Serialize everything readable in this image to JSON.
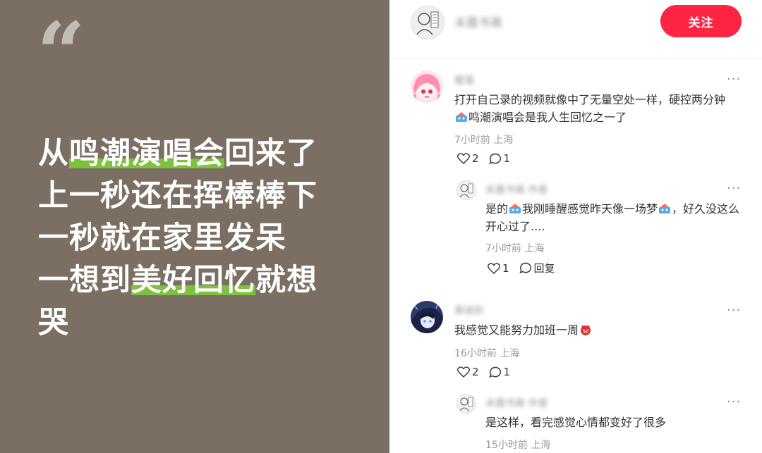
{
  "note": {
    "quote_glyph": "“",
    "lines": [
      {
        "pre": "从",
        "hl": "鸣潮演唱会",
        "post": "回来了"
      },
      {
        "pre": "上一秒还在挥棒棒下",
        "hl": "",
        "post": ""
      },
      {
        "pre": "一秒就在家里发呆",
        "hl": "",
        "post": ""
      },
      {
        "pre": "一想到",
        "hl": "美好回忆",
        "post": "就想"
      },
      {
        "pre": "哭",
        "hl": "",
        "post": ""
      }
    ],
    "highlight_color": "#7cc23d",
    "background_color": "#7b6e62"
  },
  "header": {
    "author_name": "未露书斋",
    "follow_label": "关注",
    "follow_color": "#ff2442"
  },
  "comments": [
    {
      "name": "樱落",
      "text_a": "打开自己录的视频就像中了无量空处一样，硬控两分钟",
      "text_b": "鸣潮演唱会是我人生回忆之一了",
      "meta": "7小时前 上海",
      "likes": "2",
      "replies": "1",
      "more": "···"
    },
    {
      "name": "未露书斋",
      "author_tag": "作者",
      "text_a": "是的",
      "text_b": "我刚睡醒感觉昨天像一场梦",
      "text_c": "，好久没这么开心过了....",
      "meta": "7小时前 上海",
      "likes": "1",
      "reply_label": "回复",
      "more": "···"
    },
    {
      "name": "霁夜轩",
      "text": "我感觉又能努力加班一周",
      "meta": "16小时前 上海",
      "likes": "2",
      "replies": "1",
      "more": "···"
    },
    {
      "name": "未露书斋",
      "author_tag": "作者",
      "text": "是这样，看完感觉心情都变好了很多",
      "meta": "15小时前 上海",
      "more": "···"
    }
  ]
}
